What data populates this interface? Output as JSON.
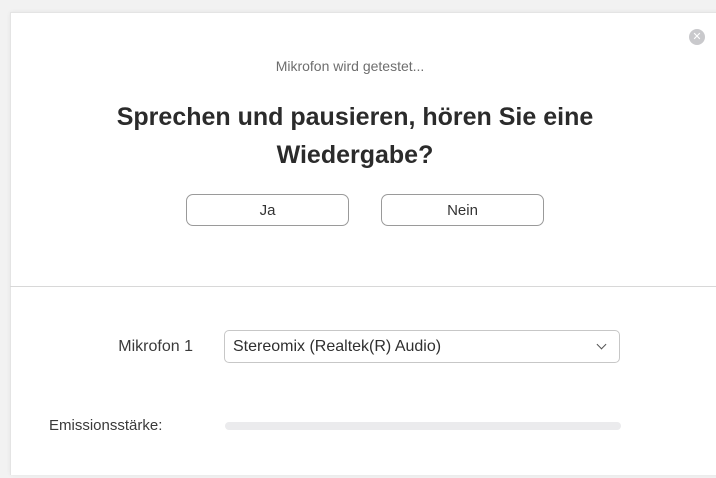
{
  "dialog": {
    "subtitle": "Mikrofon wird getestet...",
    "question": "Sprechen und pausieren, hören Sie eine Wiedergabe?",
    "buttons": {
      "yes_label": "Ja",
      "no_label": "Nein"
    },
    "close_icon": "close-icon"
  },
  "microphone": {
    "label": "Mikrofon 1",
    "selected": "Stereomix (Realtek(R) Audio)",
    "dropdown_icon": "chevron-down-icon"
  },
  "output_level": {
    "label": "Emissionsstärke:",
    "level_fraction": 0.0
  }
}
